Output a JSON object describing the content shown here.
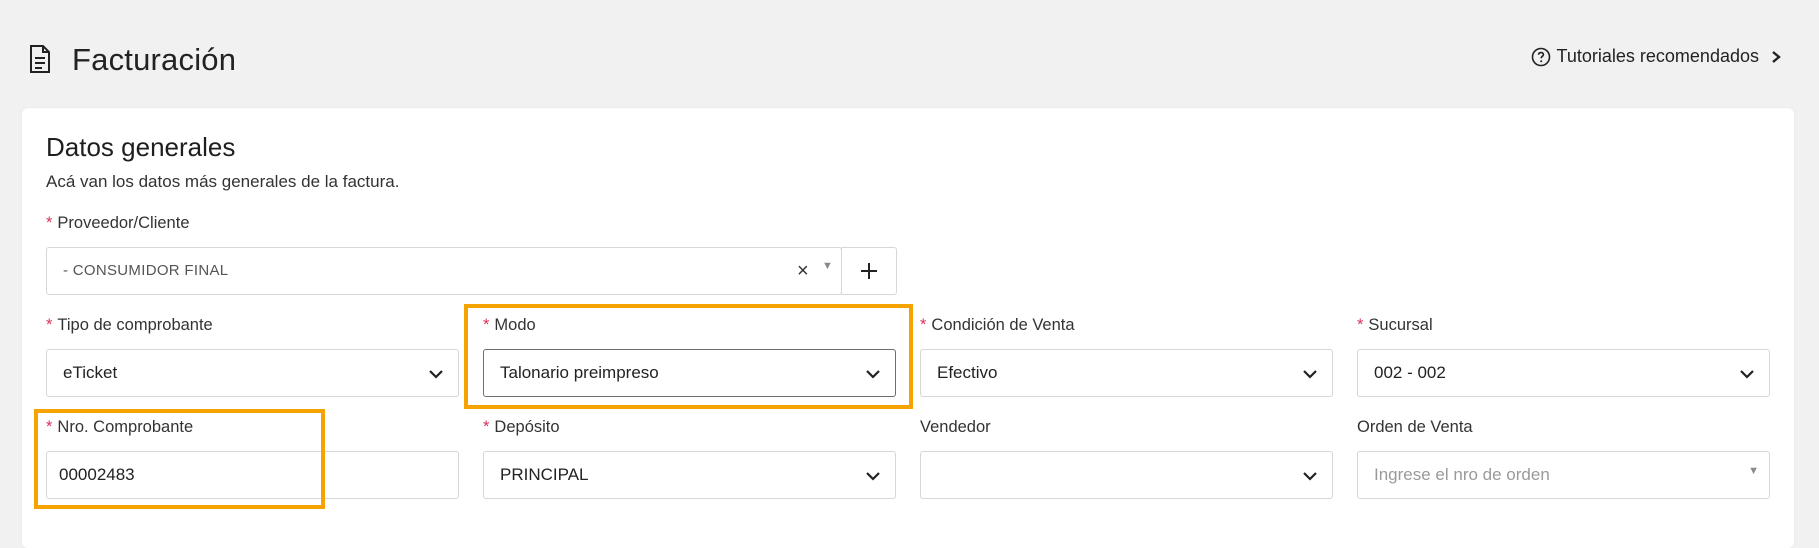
{
  "header": {
    "title": "Facturación",
    "tutorials_label": "Tutoriales recomendados"
  },
  "general": {
    "title": "Datos generales",
    "subtitle": "Acá van los datos más generales de la factura."
  },
  "fields": {
    "client": {
      "label": "Proveedor/Cliente",
      "value": "- CONSUMIDOR FINAL",
      "required": true
    },
    "tipo": {
      "label": "Tipo de comprobante",
      "value": "eTicket",
      "required": true
    },
    "modo": {
      "label": "Modo",
      "value": "Talonario preimpreso",
      "required": true
    },
    "condicion": {
      "label": "Condición de Venta",
      "value": "Efectivo",
      "required": true
    },
    "sucursal": {
      "label": "Sucursal",
      "value": "002 - 002",
      "required": true
    },
    "nro": {
      "label": "Nro. Comprobante",
      "value": "00002483",
      "required": true
    },
    "deposito": {
      "label": "Depósito",
      "value": "PRINCIPAL",
      "required": true
    },
    "vendedor": {
      "label": "Vendedor",
      "value": "",
      "required": false
    },
    "orden": {
      "label": "Orden de Venta",
      "placeholder": "Ingrese el nro de orden",
      "required": false
    }
  },
  "icons": {
    "doc": "document-icon",
    "help": "help-circle-icon",
    "chevron": "chevron-right-icon",
    "plus": "plus-icon",
    "clear": "clear-icon",
    "caret": "caret-down-icon"
  },
  "colors": {
    "required": "#d8325a",
    "highlight": "#f5a300",
    "background": "#f1f1f1"
  }
}
